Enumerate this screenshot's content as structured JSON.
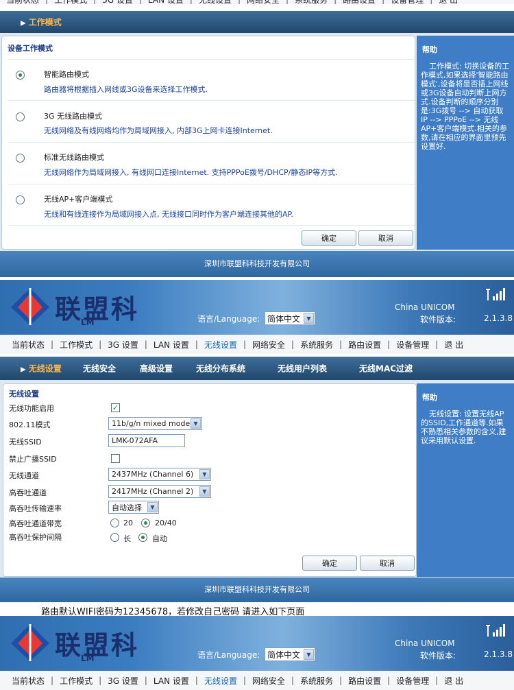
{
  "nav_items": [
    "当前状态",
    "工作模式",
    "3G 设置",
    "LAN 设置",
    "无线设置",
    "网络安全",
    "系统服务",
    "路由设置",
    "设备管理",
    "退 出"
  ],
  "nav_active": "无线设置",
  "section1": {
    "breadcrumb": "工作模式",
    "panel_title": "设备工作模式",
    "modes": [
      {
        "title": "智能路由模式",
        "desc": "路由器将根据插入网线或3G设备来选择工作模式.",
        "selected": true
      },
      {
        "title": "3G 无线路由模式",
        "desc": "无线网络及有线网络均作为局域网接入, 内部3G上网卡连接Internet.",
        "selected": false
      },
      {
        "title": "标准无线路由模式",
        "desc": "无线网络作为局域网接入, 有线网口连接Internet. 支持PPPoE拨号/DHCP/静态IP等方式.",
        "selected": false
      },
      {
        "title": "无线AP+客户端模式",
        "desc": "无线和有线连接作为局域网接入点, 无线接口同时作为客户端连接其他的AP.",
        "selected": false
      }
    ],
    "ok_label": "确定",
    "cancel_label": "取消",
    "help_title": "帮助",
    "help_text": "工作模式: 切换设备的工作模式,如果选择'智能路由模式',设备将是否插上网线或3G设备自动判断上网方式.设备判断的顺序分别是:3G拨号 --> 自动获取IP --> PPPoE --> 无线AP+客户端模式.相关的参数,请在相应的界面里预先设置好."
  },
  "footer_text": "深圳市联盟科科技开发有限公司",
  "header": {
    "logo": "联盟科",
    "logo_sub": "LM",
    "language_label": "语言/Language:",
    "language_value": "简体中文",
    "carrier": "China UNICOM",
    "version_label": "软件版本:",
    "version_value": "2.1.3.8"
  },
  "section2": {
    "tabs": [
      "无线设置",
      "无线安全",
      "高级设置",
      "无线分布系统",
      "无线用户列表",
      "无线MAC过滤"
    ],
    "panel_title": "无线设置",
    "fields": {
      "wifi_enable_label": "无线功能启用",
      "mode_label": "802.11模式",
      "mode_value": "11b/g/n mixed mode",
      "ssid_label": "无线SSID",
      "ssid_value": "LMK-072AFA",
      "hide_ssid_label": "禁止广播SSID",
      "channel_label": "无线通道",
      "channel_value": "2437MHz (Channel 6)",
      "ht_channel_label": "高吞吐通道",
      "ht_channel_value": "2417MHz (Channel 2)",
      "ht_rate_label": "高吞吐传输速率",
      "ht_rate_value": "自动选择",
      "ht_bw_label": "高吞吐通道带宽",
      "ht_bw_opt1": "20",
      "ht_bw_opt2": "20/40",
      "ht_gi_label": "高吞吐保护间隔",
      "ht_gi_opt1": "长",
      "ht_gi_opt2": "自动"
    },
    "ok_label": "确定",
    "cancel_label": "取消",
    "help_title": "帮助",
    "help_text": "无线设置: 设置无线AP的SSID,工作通道等.如果不熟悉相关参数的含义,建议采用默认设置."
  },
  "note_text": "路由默认WIFI密码为12345678，若修改自己密码 请进入如下页面"
}
